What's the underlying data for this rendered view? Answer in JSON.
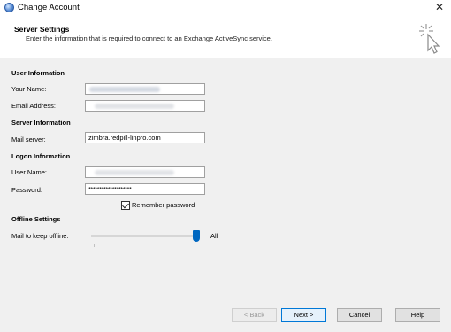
{
  "window": {
    "title": "Change Account",
    "close_glyph": "✕"
  },
  "header": {
    "title": "Server Settings",
    "subtitle": "Enter the information that is required to connect to an Exchange ActiveSync service."
  },
  "sections": {
    "user_info": "User Information",
    "server_info": "Server Information",
    "logon_info": "Logon Information",
    "offline": "Offline Settings"
  },
  "fields": {
    "your_name": {
      "label": "Your Name:",
      "value": ""
    },
    "email": {
      "label": "Email Address:",
      "value": ""
    },
    "mail_server": {
      "label": "Mail server:",
      "value": "zimbra.redpill-linpro.com"
    },
    "user_name": {
      "label": "User Name:",
      "value": ""
    },
    "password": {
      "label": "Password:",
      "value": "********************"
    }
  },
  "remember_password": {
    "label": "Remember password",
    "checked": true
  },
  "offline_slider": {
    "label": "Mail to keep offline:",
    "value": "All",
    "level": 1.0
  },
  "buttons": {
    "back": "< Back",
    "next": "Next >",
    "cancel": "Cancel",
    "help": "Help"
  },
  "icons": {
    "app": "outlook-account-icon",
    "header": "pointer-click-icon"
  },
  "colors": {
    "accent": "#0067c0",
    "body_bg": "#f0f0f0"
  }
}
